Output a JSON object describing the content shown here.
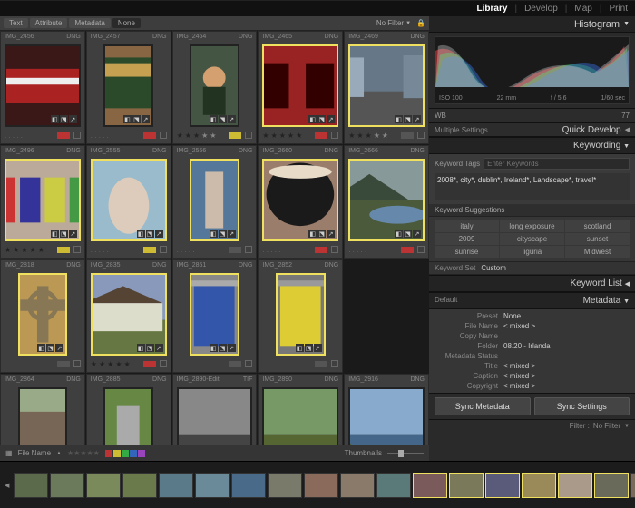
{
  "topbar": {
    "modules": [
      "Library",
      "Develop",
      "Map",
      "Print"
    ],
    "active": 0
  },
  "filter": {
    "tabs": [
      "Text",
      "Attribute",
      "Metadata",
      "None"
    ],
    "active": 3,
    "noFilter": "No Filter"
  },
  "panels": {
    "histogram": "Histogram",
    "quickDevelop": "Quick Develop",
    "keywording": "Keywording",
    "keywordList": "Keyword List",
    "metadata": "Metadata",
    "suggestions": "Keyword Suggestions"
  },
  "histogram": {
    "iso": "ISO 100",
    "focal": "22 mm",
    "aperture": "f / 5.6",
    "shutter": "1/60 sec",
    "wb": "WB",
    "temp": "77"
  },
  "quickDev": {
    "multi": "Multiple Settings"
  },
  "keywording": {
    "tagsLabel": "Keyword Tags",
    "placeholder": "Enter Keywords",
    "tags": "2008*, city*, dublin*, Ireland*, Landscape*, travel*",
    "sugs": [
      "italy",
      "long exposure",
      "scotland",
      "2009",
      "cityscape",
      "sunset",
      "sunrise",
      "liguria",
      "Midwest"
    ],
    "setLabel": "Keyword Set",
    "setValue": "Custom"
  },
  "metadata": {
    "default": "Default",
    "preset": "Preset",
    "presetVal": "None",
    "rows": [
      {
        "k": "File Name",
        "v": "< mixed >"
      },
      {
        "k": "Copy Name",
        "v": ""
      },
      {
        "k": "Folder",
        "v": "08.20 - Irlanda"
      },
      {
        "k": "Metadata Status",
        "v": ""
      },
      {
        "k": "Title",
        "v": "< mixed >"
      },
      {
        "k": "Caption",
        "v": "< mixed >"
      },
      {
        "k": "Copyright",
        "v": "< mixed >"
      }
    ]
  },
  "sync": {
    "meta": "Sync Metadata",
    "settings": "Sync Settings"
  },
  "bottom": {
    "sortLabel": "File Name",
    "thumbs": "Thumbnails",
    "filter": "Filter :",
    "noFilter": "No Filter"
  },
  "colors": {
    "red": "#bb3333",
    "yellow": "#ccbb33",
    "green": "#33aa44",
    "blue": "#3366bb",
    "purple": "#9944bb",
    "none": "#555"
  },
  "grid": [
    {
      "name": "IMG_2456",
      "fmt": "DNG",
      "stars": 0,
      "color": "red",
      "sel": false,
      "inner": "dark-pub"
    },
    {
      "name": "IMG_2457",
      "fmt": "DNG",
      "stars": 0,
      "color": "red",
      "sel": false,
      "inner": "guinness-ad"
    },
    {
      "name": "IMG_2464",
      "fmt": "DNG",
      "stars": 3,
      "color": "yellow",
      "sel": false,
      "inner": "accordion-man"
    },
    {
      "name": "IMG_2465",
      "fmt": "DNG",
      "stars": 5,
      "color": "red",
      "sel": true,
      "inner": "pub-front"
    },
    {
      "name": "IMG_2469",
      "fmt": "DNG",
      "stars": 3,
      "color": "none",
      "sel": true,
      "inner": "street-scene"
    },
    {
      "name": "IMG_2496",
      "fmt": "DNG",
      "stars": 5,
      "color": "yellow",
      "sel": true,
      "inner": "colored-doors"
    },
    {
      "name": "IMG_2555",
      "fmt": "DNG",
      "stars": 0,
      "color": "yellow",
      "sel": true,
      "inner": "statue-figure"
    },
    {
      "name": "IMG_2556",
      "fmt": "DNG",
      "stars": 0,
      "color": "none",
      "sel": true,
      "inner": "standing-statue"
    },
    {
      "name": "IMG_2660",
      "fmt": "DNG",
      "stars": 0,
      "color": "red",
      "sel": true,
      "inner": "guinness-pint"
    },
    {
      "name": "IMG_2666",
      "fmt": "DNG",
      "stars": 0,
      "color": "red",
      "sel": true,
      "inner": "valley-lake"
    },
    {
      "name": "IMG_2818",
      "fmt": "DNG",
      "stars": 0,
      "color": "none",
      "sel": true,
      "inner": "celtic-cross"
    },
    {
      "name": "IMG_2835",
      "fmt": "DNG",
      "stars": 5,
      "color": "red",
      "sel": true,
      "inner": "cottage-row"
    },
    {
      "name": "IMG_2851",
      "fmt": "DNG",
      "stars": 0,
      "color": "none",
      "sel": true,
      "inner": "blue-door"
    },
    {
      "name": "IMG_2852",
      "fmt": "DNG",
      "stars": 0,
      "color": "none",
      "sel": true,
      "inner": "yellow-door"
    },
    {
      "name": "",
      "fmt": "",
      "stars": 0,
      "color": "",
      "sel": false,
      "inner": "empty"
    },
    {
      "name": "IMG_2864",
      "fmt": "DNG",
      "stars": 0,
      "color": "none",
      "sel": false,
      "inner": "ruins"
    },
    {
      "name": "IMG_2885",
      "fmt": "DNG",
      "stars": 0,
      "color": "none",
      "sel": false,
      "inner": "marker"
    },
    {
      "name": "IMG_2890-Edit",
      "fmt": "TIF",
      "stars": 0,
      "color": "none",
      "sel": false,
      "inner": "landscape-bw"
    },
    {
      "name": "IMG_2890",
      "fmt": "DNG",
      "stars": 0,
      "color": "none",
      "sel": false,
      "inner": "landscape"
    },
    {
      "name": "IMG_2916",
      "fmt": "DNG",
      "stars": 0,
      "color": "none",
      "sel": false,
      "inner": "cliff"
    }
  ],
  "filmstrip": [
    "valley",
    "hills",
    "field",
    "field2",
    "lake",
    "coast",
    "cliff",
    "stone",
    "street",
    "street2",
    "island",
    "door",
    "door2",
    "door3",
    "cross",
    "cottage",
    "tower",
    "ruin",
    "church",
    "shore",
    "hill2"
  ]
}
